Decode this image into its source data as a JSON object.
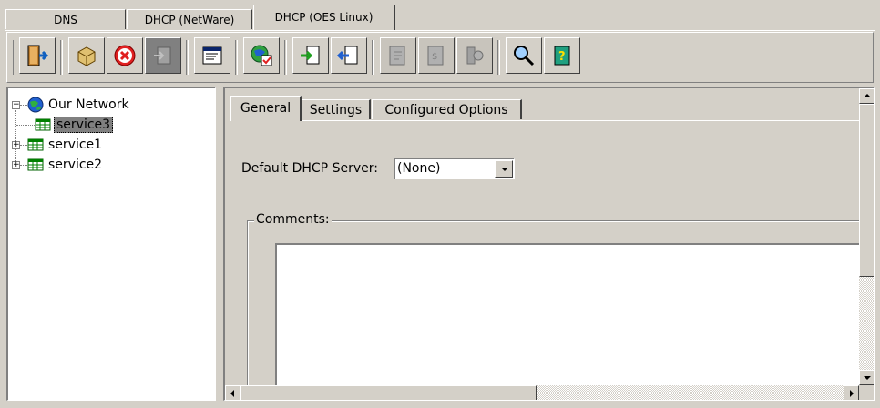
{
  "top_tabs": [
    {
      "label": "DNS",
      "active": false
    },
    {
      "label": "DHCP (NetWare)",
      "active": false
    },
    {
      "label": "DHCP (OES Linux)",
      "active": true
    }
  ],
  "toolbar": {
    "icons": [
      "exit-icon",
      "save-icon",
      "delete-icon",
      "import-icon",
      "view-icon",
      "global-options-icon",
      "export-icon",
      "log-icon",
      "address-icon",
      "range-icon",
      "server-icon",
      "search-icon",
      "help-icon"
    ]
  },
  "tree": {
    "root": "Our Network",
    "items": [
      {
        "label": "service3",
        "selected": true
      },
      {
        "label": "service1",
        "selected": false
      },
      {
        "label": "service2",
        "selected": false
      }
    ]
  },
  "inner_tabs": [
    {
      "label": "General",
      "active": true
    },
    {
      "label": "Settings",
      "active": false
    },
    {
      "label": "Configured Options",
      "active": false
    }
  ],
  "form": {
    "default_server_label": "Default DHCP Server:",
    "default_server_value": "(None)",
    "comments_label": "Comments:",
    "comments_value": ""
  },
  "colors": {
    "face": "#d4d0c8",
    "shadow": "#808080",
    "highlight": "#ffffff",
    "selection": "#808080"
  }
}
